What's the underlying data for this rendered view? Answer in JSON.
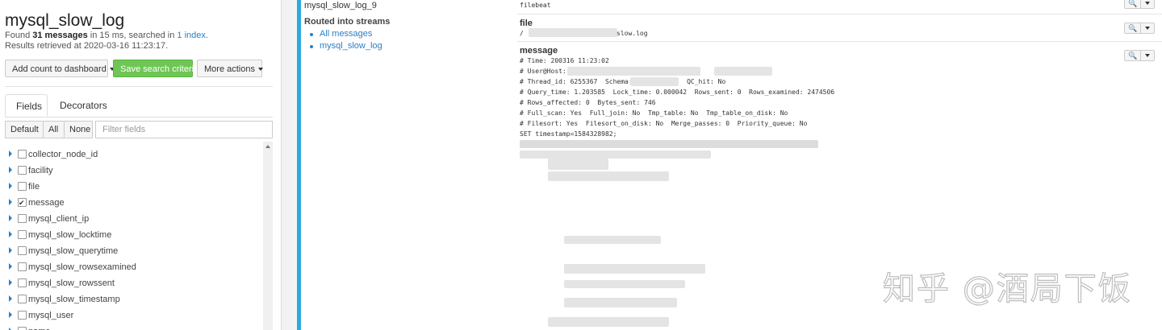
{
  "search": {
    "title": "mysql_slow_log",
    "found_prefix": "Found ",
    "count": "31 messages",
    "found_mid": " in 15 ms, searched in ",
    "index_link": "1 index",
    "found_suffix": ".",
    "retrieved": "Results retrieved at 2020-03-16 11:23:17."
  },
  "actions": {
    "add_count": "Add count to dashboard",
    "save_criteria": "Save search criteria",
    "more_actions": "More actions"
  },
  "tabs": [
    "Fields",
    "Decorators"
  ],
  "field_filter": {
    "default_label": "Default",
    "all_label": "All",
    "none_label": "None",
    "placeholder": "Filter fields"
  },
  "fields": [
    {
      "name": "collector_node_id",
      "checked": false
    },
    {
      "name": "facility",
      "checked": false
    },
    {
      "name": "file",
      "checked": false
    },
    {
      "name": "message",
      "checked": true
    },
    {
      "name": "mysql_client_ip",
      "checked": false
    },
    {
      "name": "mysql_slow_locktime",
      "checked": false
    },
    {
      "name": "mysql_slow_querytime",
      "checked": false
    },
    {
      "name": "mysql_slow_rowsexamined",
      "checked": false
    },
    {
      "name": "mysql_slow_rowssent",
      "checked": false
    },
    {
      "name": "mysql_slow_timestamp",
      "checked": false
    },
    {
      "name": "mysql_user",
      "checked": false
    },
    {
      "name": "name",
      "checked": false
    }
  ],
  "message_detail": {
    "stream_name": "mysql_slow_log_9",
    "routed_label": "Routed into streams",
    "streams": [
      "All messages",
      "mysql_slow_log"
    ],
    "source_value": "filebeat",
    "file_label": "file",
    "file_prefix": "/",
    "file_suffix": "slow.log",
    "message_label": "message",
    "message_lines": [
      "# Time: 200316 11:23:02",
      "# User@Host:                                @ ",
      "# Thread_id: 6255367  Schema:              QC_hit: No",
      "# Query_time: 1.203585  Lock_time: 0.000042  Rows_sent: 0  Rows_examined: 2474506",
      "# Rows_affected: 0  Bytes_sent: 746",
      "# Full_scan: Yes  Full_join: No  Tmp_table: No  Tmp_table_on_disk: No",
      "# Filesort: Yes  Filesort_on_disk: No  Merge_passes: 0  Priority_queue: No",
      "SET timestamp=1584328982;"
    ]
  },
  "watermark": "知乎 @酒局下饭"
}
